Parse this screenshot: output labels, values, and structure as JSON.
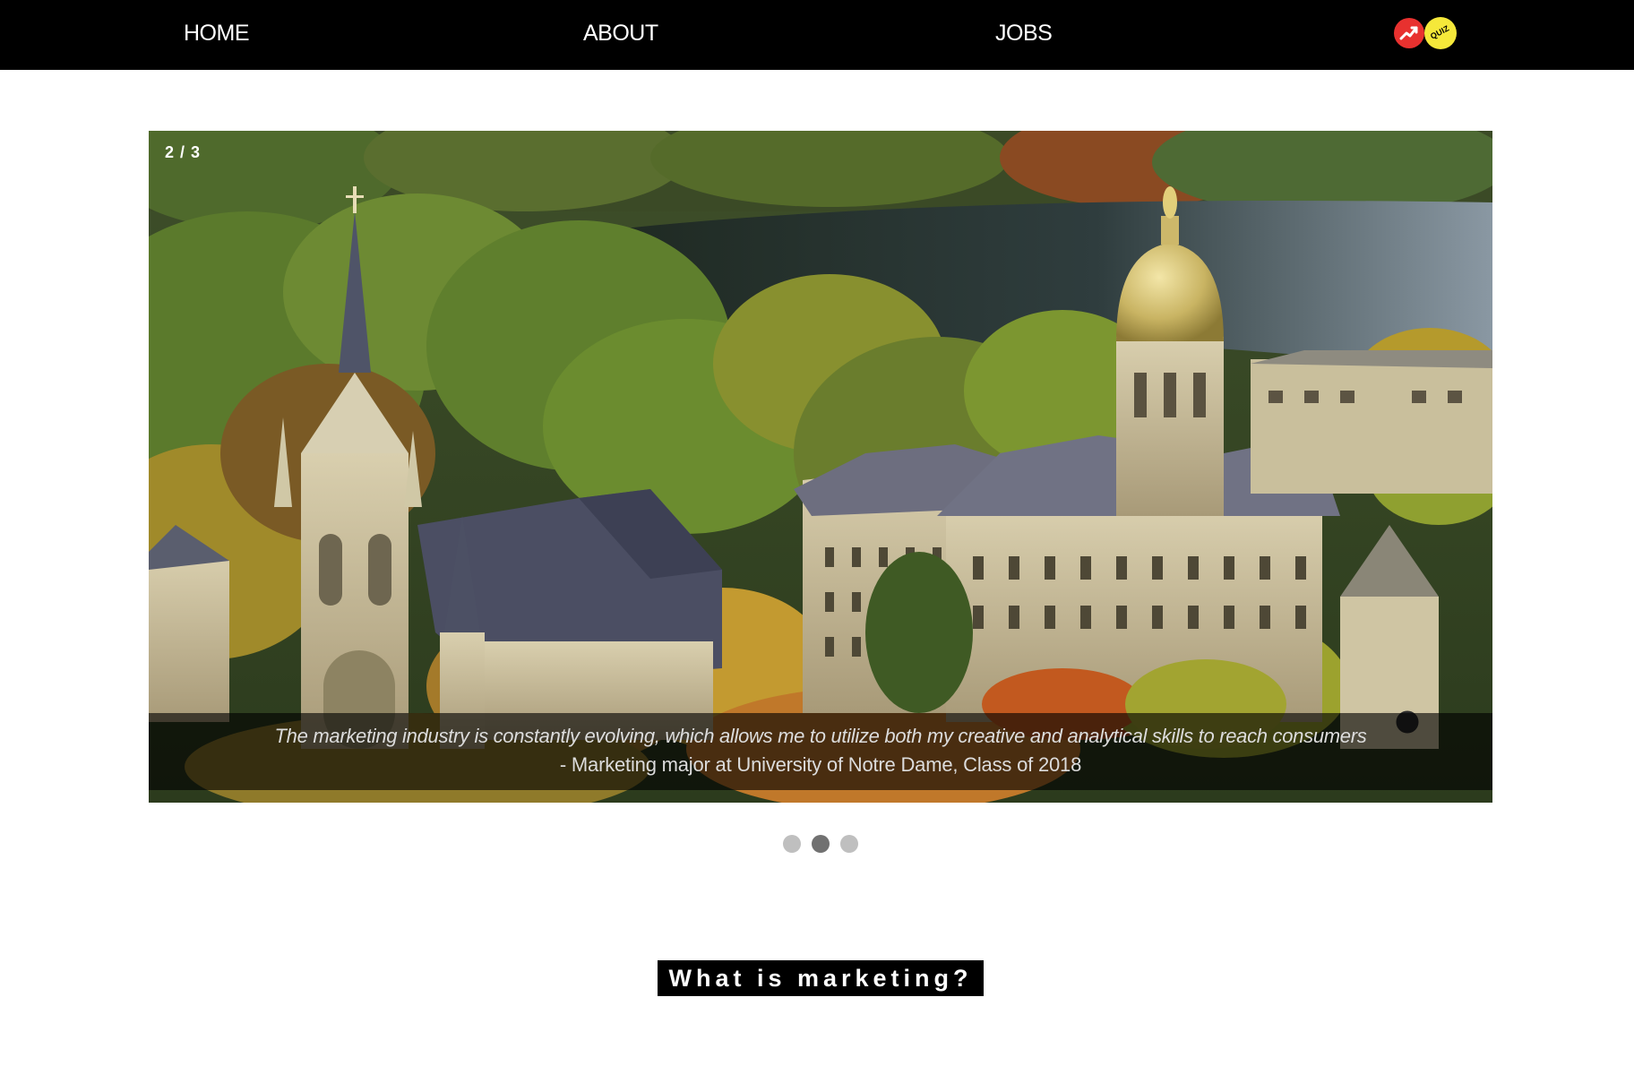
{
  "nav": {
    "home": "HOME",
    "about": "ABOUT",
    "jobs": "JOBS",
    "logo_text": "QUIZ"
  },
  "slideshow": {
    "counter": "2 / 3",
    "quote": "The marketing industry is constantly evolving, which allows me to utilize both my creative and analytical skills to reach consumers",
    "attribution": "- Marketing major at University of Notre Dame, Class of 2018",
    "total_slides": 3,
    "active_slide": 2
  },
  "section": {
    "heading": "What is marketing?"
  },
  "colors": {
    "navbar_bg": "#000000",
    "logo_red": "#e8312f",
    "logo_yellow": "#f5e83a",
    "dot_inactive": "#bfbfbf",
    "dot_active": "#717171"
  }
}
